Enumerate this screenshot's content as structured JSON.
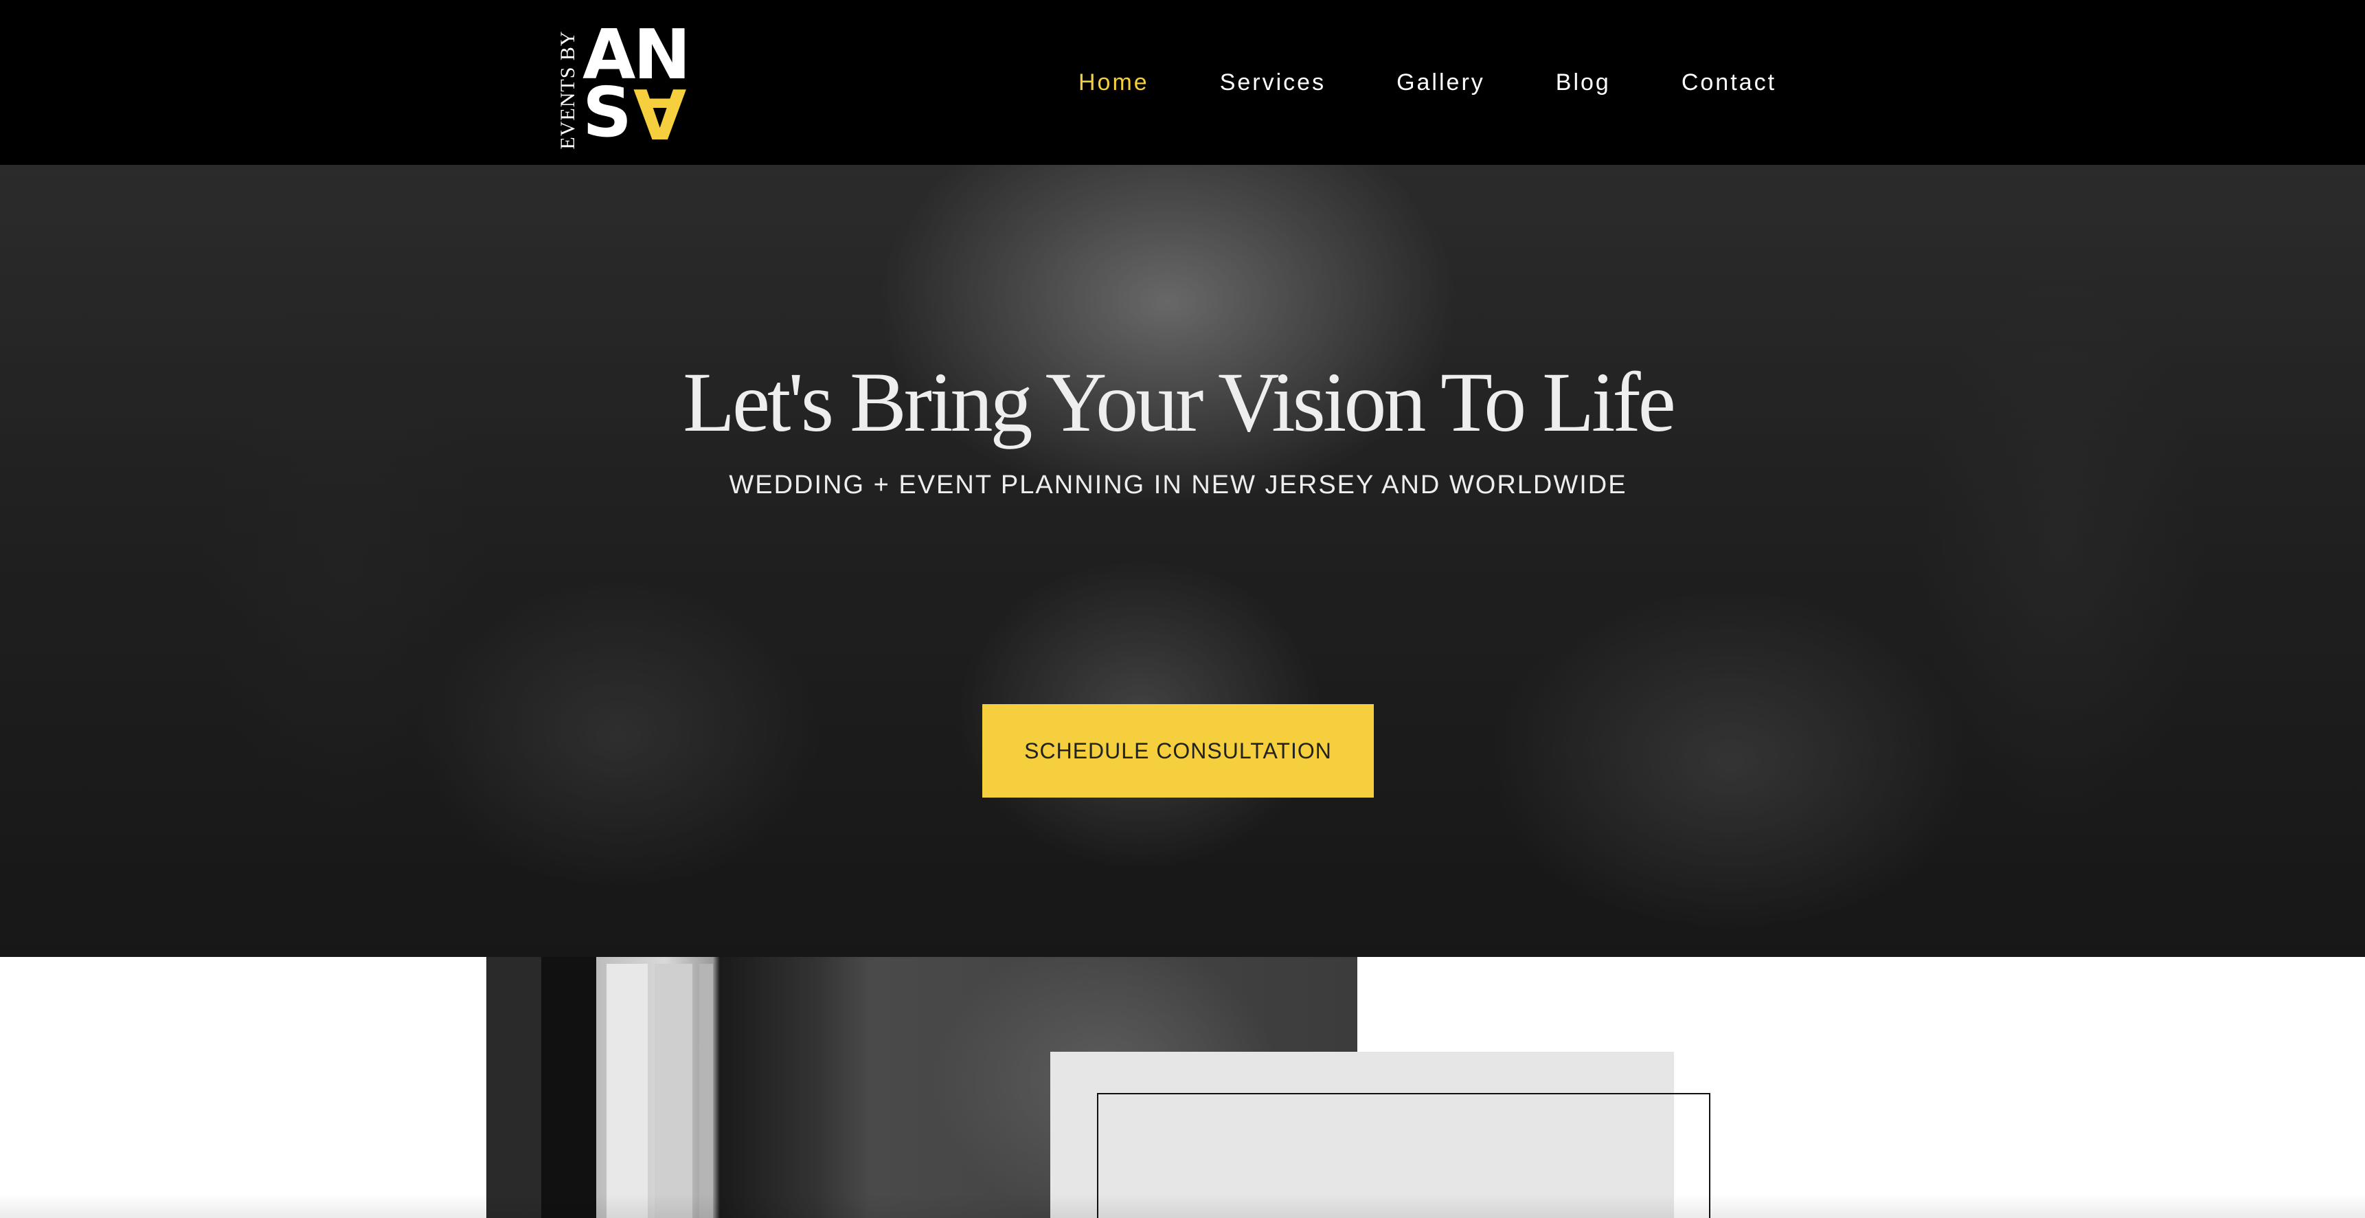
{
  "brand": {
    "side_text": "EVENTS BY",
    "logo_letters": [
      "A",
      "N",
      "S",
      "A"
    ],
    "accent_color": "#f5cf3d"
  },
  "nav": {
    "items": [
      {
        "label": "Home",
        "active": true
      },
      {
        "label": "Services",
        "active": false
      },
      {
        "label": "Gallery",
        "active": false
      },
      {
        "label": "Blog",
        "active": false
      },
      {
        "label": "Contact",
        "active": false
      }
    ]
  },
  "hero": {
    "title": "Let's Bring Your Vision To Life",
    "subtitle": "WEDDING + EVENT PLANNING IN NEW JERSEY AND WORLDWIDE",
    "cta_label": "SCHEDULE CONSULTATION"
  }
}
